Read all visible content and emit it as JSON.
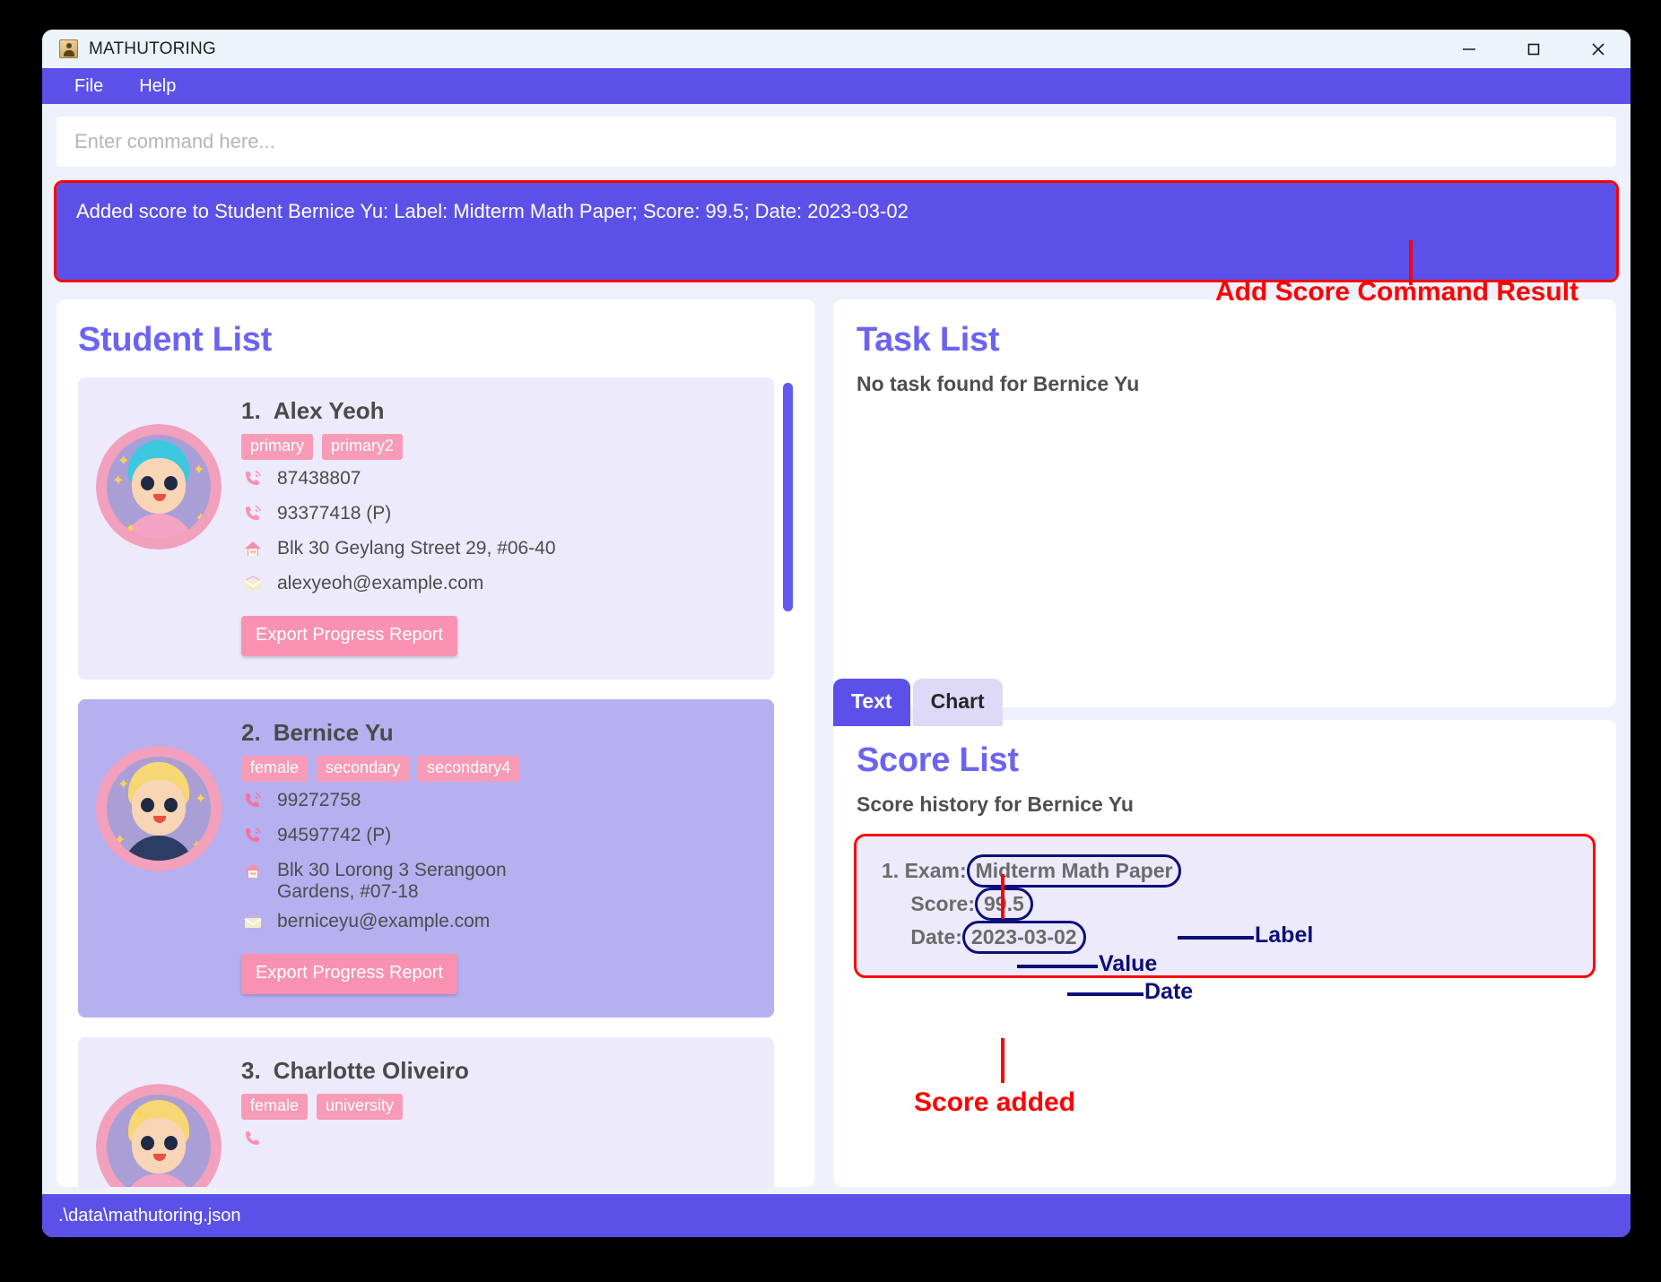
{
  "window": {
    "title": "MATHUTORING",
    "app_icon": "contact-card-icon",
    "controls": {
      "minimize": "minimize-icon",
      "maximize": "maximize-icon",
      "close": "close-icon"
    }
  },
  "menubar": {
    "items": [
      {
        "label": "File"
      },
      {
        "label": "Help"
      }
    ]
  },
  "command": {
    "placeholder": "Enter command here...",
    "value": "",
    "result": "Added score to Student Bernice Yu: Label: Midterm Math Paper; Score: 99.5; Date: 2023-03-02"
  },
  "student_list": {
    "title": "Student List",
    "export_label": "Export Progress Report",
    "students": [
      {
        "index": "1.",
        "name": "Alex Yeoh",
        "tags": [
          "primary",
          "primary2"
        ],
        "phone": "87438807",
        "phone_parent": "93377418 (P)",
        "address": "Blk 30 Geylang Street 29, #06-40",
        "email": "alexyeoh@example.com",
        "selected": false,
        "hair_color": "#3cc8e0",
        "shirt_color": "#f3a4c4"
      },
      {
        "index": "2.",
        "name": "Bernice Yu",
        "tags": [
          "female",
          "secondary",
          "secondary4"
        ],
        "phone": "99272758",
        "phone_parent": "94597742 (P)",
        "address": "Blk 30 Lorong 3 Serangoon Gardens, #07-18",
        "email": "berniceyu@example.com",
        "selected": true,
        "hair_color": "#f7d774",
        "shirt_color": "#2c3c62"
      },
      {
        "index": "3.",
        "name": "Charlotte Oliveiro",
        "tags": [
          "female",
          "university"
        ],
        "phone": "",
        "phone_parent": "",
        "address": "",
        "email": "",
        "selected": false,
        "hair_color": "#f7d774",
        "shirt_color": "#f3a4c4"
      }
    ]
  },
  "task_list": {
    "title": "Task List",
    "empty_message": "No task found for Bernice Yu"
  },
  "detail_tabs": {
    "tabs": [
      {
        "label": "Text",
        "active": true
      },
      {
        "label": "Chart",
        "active": false
      }
    ]
  },
  "score_list": {
    "title": "Score List",
    "subtitle": "Score history for Bernice Yu",
    "entries": [
      {
        "index": "1.",
        "exam_label": "Exam:",
        "exam_value": "Midterm Math Paper",
        "score_label": "Score:",
        "score_value": "99.5",
        "date_label": "Date:",
        "date_value": "2023-03-02"
      }
    ]
  },
  "annotations": {
    "command_result": "Add Score Command Result",
    "score_added": "Score added",
    "label": "Label",
    "value": "Value",
    "date": "Date"
  },
  "statusbar": {
    "path": ".\\data\\mathutoring.json"
  },
  "colors": {
    "accent": "#5b51e8",
    "heading": "#6c63f3",
    "tag": "#f79bb6",
    "selected_card": "#b6b0f0",
    "card": "#eceafb",
    "annotation_red": "#ff0000",
    "annotation_navy": "#0b0f7a"
  }
}
